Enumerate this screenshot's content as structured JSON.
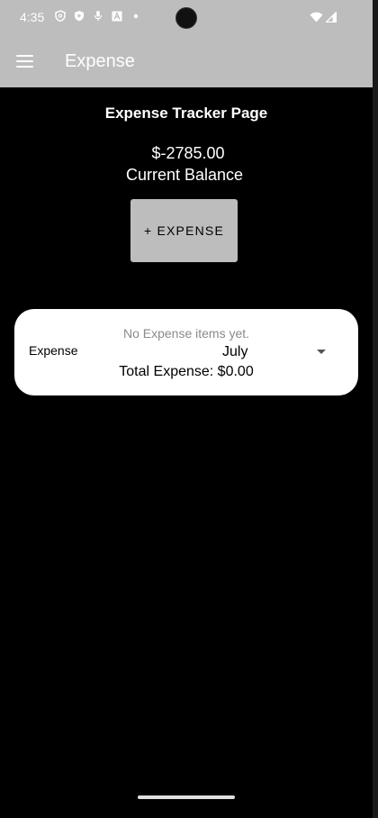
{
  "status_bar": {
    "time": "4:35",
    "left_icons": [
      "shield-icon",
      "play-protect-icon",
      "mic-icon",
      "font-icon",
      "dot-icon"
    ],
    "right_icons": [
      "wifi-icon",
      "signal-icon"
    ]
  },
  "app_bar": {
    "title": "Expense",
    "color": "#bdbdbd"
  },
  "page": {
    "heading": "Expense Tracker Page",
    "balance_amount": "$-2785.00",
    "balance_label": "Current Balance",
    "add_expense_label": "+ EXPENSE"
  },
  "expense_card": {
    "label": "Expense",
    "empty_message": "No Expense items yet.",
    "month_selected": "July",
    "total": "Total Expense: $0.00"
  }
}
